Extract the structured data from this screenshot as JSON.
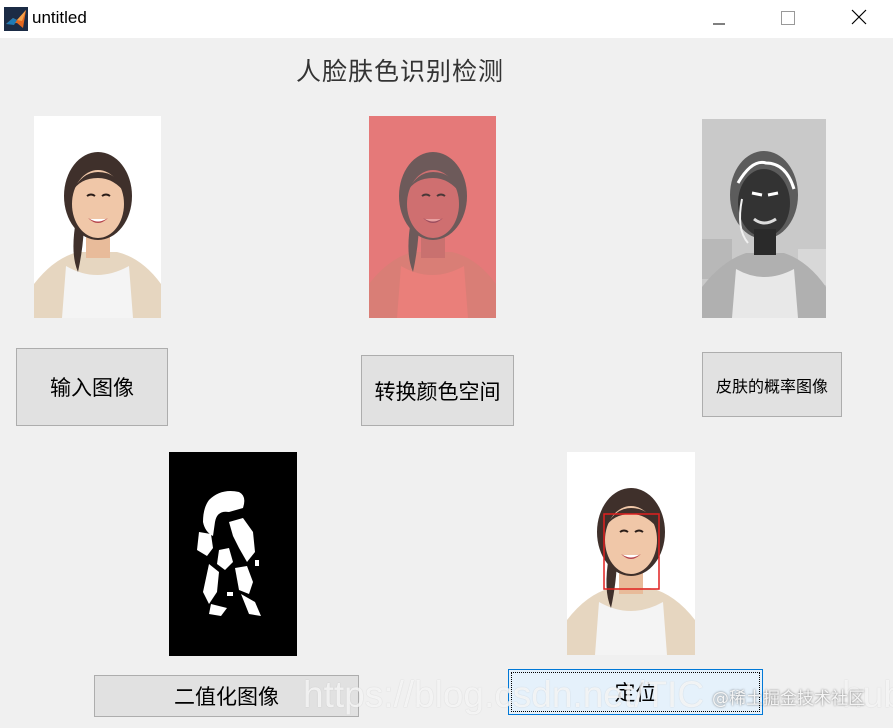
{
  "window": {
    "title": "untitled",
    "icon": "matlab-icon",
    "controls": [
      "minimize-icon",
      "maximize-icon",
      "close-icon"
    ]
  },
  "heading": "人脸肤色识别检测",
  "images": {
    "input": "input-face-photo",
    "color_space": "color-space-photo",
    "probability": "skin-probability-map",
    "binary": "binary-mask",
    "located": "located-face-photo"
  },
  "buttons": {
    "input": "输入图像",
    "convert": "转换颜色空间",
    "probability": "皮肤的概率图像",
    "binary": "二值化图像",
    "locate": "定位"
  },
  "watermark": {
    "url": "https://blog.csdn.net/TIC",
    "suffix": "hub",
    "site": "@稀土掘金技术社区"
  },
  "colors": {
    "window_bg": "#f0f0f0",
    "button_bg": "#e1e1e1",
    "focus_border": "#0078d7",
    "face_box": "#e02020",
    "color_space_tint": "#e57979"
  }
}
